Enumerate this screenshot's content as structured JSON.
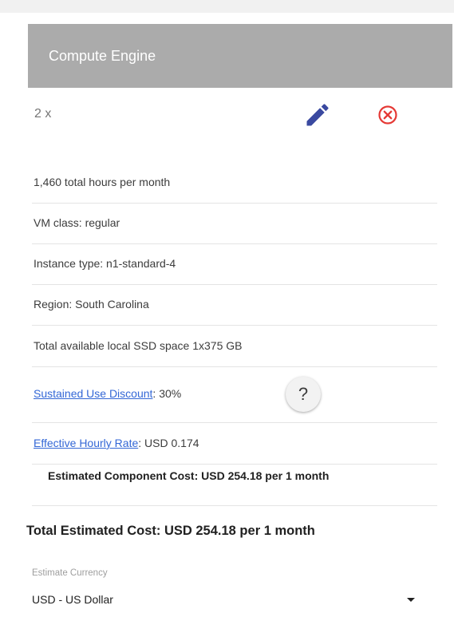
{
  "card": {
    "title": "Compute Engine",
    "quantity": "2 x",
    "edit_icon": "pencil-icon",
    "remove_icon": "close-circle-icon",
    "details": [
      "1,460 total hours per month",
      "VM class: regular",
      "Instance type: n1-standard-4",
      "Region: South Carolina",
      "Total available local SSD space 1x375 GB"
    ],
    "sustained_use": {
      "link_text": "Sustained Use Discount",
      "value": ": 30%",
      "help_label": "?"
    },
    "effective_rate": {
      "link_text": "Effective Hourly Rate",
      "value": ": USD 0.174"
    },
    "component_cost": "Estimated Component Cost: USD 254.18 per 1 month"
  },
  "total": {
    "text": "Total Estimated Cost: USD 254.18 per 1 month"
  },
  "currency": {
    "label": "Estimate Currency",
    "selected": "USD - US Dollar"
  },
  "colors": {
    "header_bg": "#ababab",
    "accent_blue": "#3a49a0",
    "remove_red": "#e53935",
    "link_blue": "#3367d6"
  }
}
